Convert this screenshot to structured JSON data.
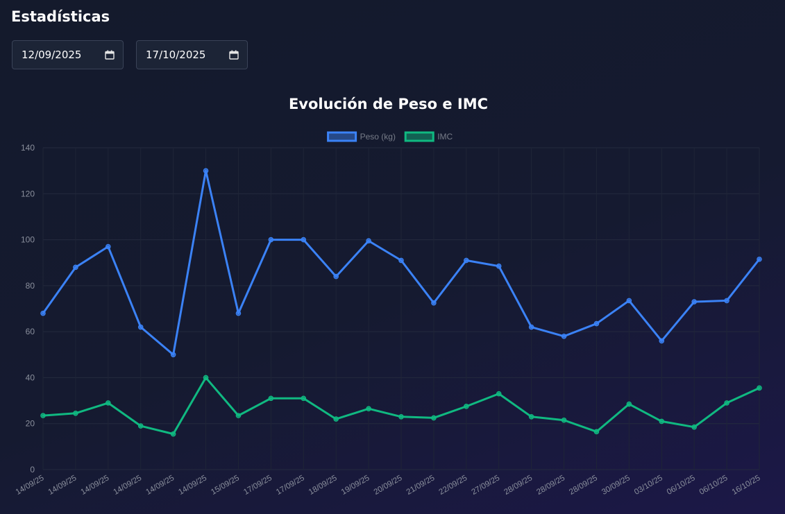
{
  "page": {
    "title": "Estadísticas"
  },
  "filters": {
    "from_date": "12/09/2025",
    "to_date": "17/10/2025"
  },
  "colors": {
    "weight": "#3b82f6",
    "bmi": "#10b981"
  },
  "chart_data": {
    "type": "line",
    "title": "Evolución de Peso e IMC",
    "categories": [
      "14/09/25",
      "14/09/25",
      "14/09/25",
      "14/09/25",
      "14/09/25",
      "14/09/25",
      "15/09/25",
      "17/09/25",
      "17/09/25",
      "18/09/25",
      "19/09/25",
      "20/09/25",
      "21/09/25",
      "22/09/25",
      "27/09/25",
      "28/09/25",
      "28/09/25",
      "28/09/25",
      "30/09/25",
      "03/10/25",
      "06/10/25",
      "06/10/25",
      "16/10/25"
    ],
    "series": [
      {
        "name": "Peso (kg)",
        "color": "#3b82f6",
        "values": [
          68,
          88,
          97,
          62,
          50,
          130,
          68,
          100,
          100,
          84,
          99.5,
          91,
          72.5,
          91,
          88.5,
          62,
          58,
          63.5,
          73.5,
          56,
          73,
          73.5,
          91.5
        ]
      },
      {
        "name": "IMC",
        "color": "#10b981",
        "values": [
          23.5,
          24.5,
          29,
          19,
          15.5,
          40,
          23.5,
          31,
          31,
          22,
          26.5,
          23,
          22.5,
          27.5,
          33,
          23,
          21.5,
          16.5,
          28.5,
          21,
          18.5,
          29,
          35.5
        ]
      }
    ],
    "ylim": [
      0,
      140
    ],
    "yticks": [
      0,
      20,
      40,
      60,
      80,
      100,
      120,
      140
    ],
    "grid": true,
    "legend": "top-center"
  }
}
